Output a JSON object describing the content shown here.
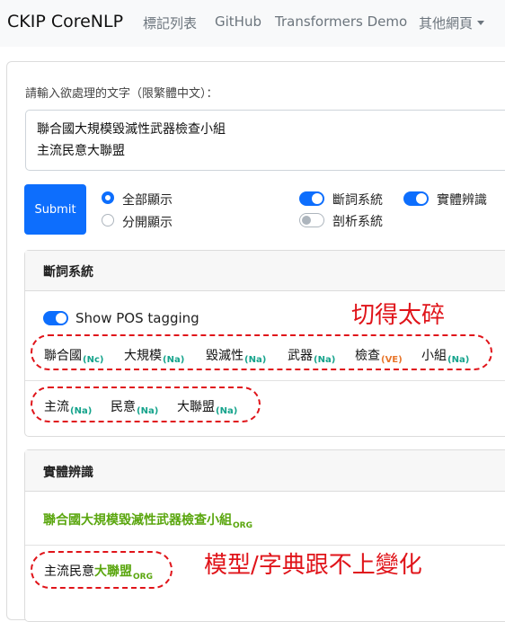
{
  "navbar": {
    "brand": "CKIP CoreNLP",
    "links": [
      "標記列表",
      "GitHub",
      "Transformers Demo",
      "其他網頁"
    ]
  },
  "form": {
    "prompt": "請輸入欲處理的文字（限繁體中文）：",
    "text_lines": [
      "聯合國大規模毀滅性武器檢查小組",
      "主流民意大聯盟"
    ],
    "submit": "Submit",
    "display_options": [
      {
        "label": "全部顯示",
        "checked": true
      },
      {
        "label": "分開顯示",
        "checked": false
      }
    ],
    "systems": [
      {
        "label": "斷詞系統",
        "on": true
      },
      {
        "label": "實體辨識",
        "on": true
      },
      {
        "label": "剖析系統",
        "on": false
      }
    ]
  },
  "ws_card": {
    "title": "斷詞系統",
    "show_pos_label": "Show POS tagging",
    "show_pos_on": true,
    "sentences": [
      [
        {
          "word": "聯合國",
          "pos": "(Nc)"
        },
        {
          "word": "大規模",
          "pos": "(Na)"
        },
        {
          "word": "毀滅性",
          "pos": "(Na)"
        },
        {
          "word": "武器",
          "pos": "(Na)"
        },
        {
          "word": "檢查",
          "pos": "(VE)"
        },
        {
          "word": "小組",
          "pos": "(Na)"
        }
      ],
      [
        {
          "word": "主流",
          "pos": "(Na)"
        },
        {
          "word": "民意",
          "pos": "(Na)"
        },
        {
          "word": "大聯盟",
          "pos": "(Na)"
        }
      ]
    ]
  },
  "ner_card": {
    "title": "實體辨識",
    "line1": {
      "entity": "聯合國大規模毀滅性武器檢查小組",
      "type": "ORG"
    },
    "line2": {
      "plain": "主流民意",
      "entity": "大聯盟",
      "type": "ORG"
    }
  },
  "annotations": {
    "too_fragmented": "切得太碎",
    "model_lag": "模型/字典跟不上變化"
  },
  "colors": {
    "primary": "#0d6efd",
    "pos_tag": "#14a38b",
    "pos_tag_verb": "#e8762b",
    "org_entity": "#5aa60e",
    "annotation_red": "#e0141a"
  }
}
